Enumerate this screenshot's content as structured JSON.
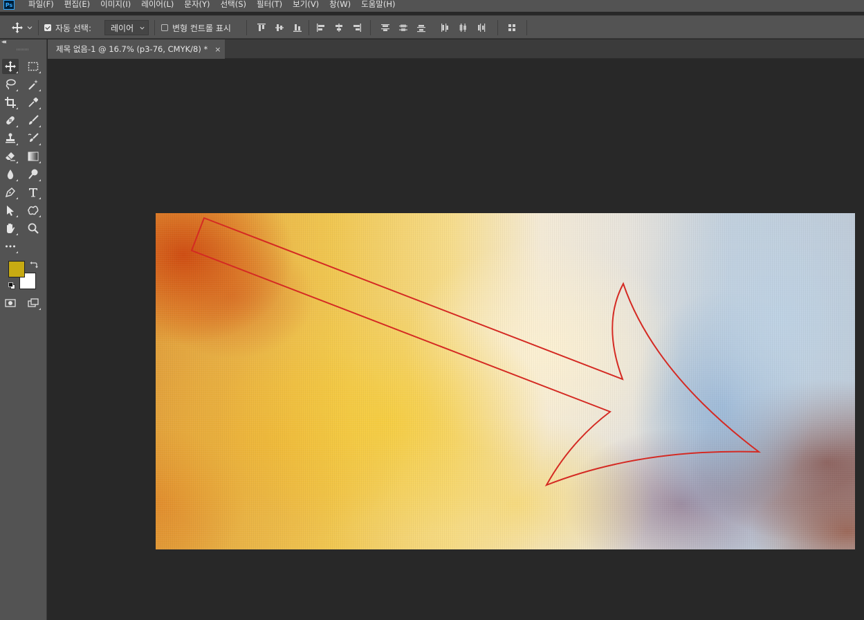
{
  "app": {
    "logo": "Ps",
    "menu": [
      "파일(F)",
      "편집(E)",
      "이미지(I)",
      "레이어(L)",
      "문자(Y)",
      "선택(S)",
      "필터(T)",
      "보기(V)",
      "창(W)",
      "도움말(H)"
    ]
  },
  "options_bar": {
    "tool_icon": "move-icon",
    "auto_select_checked": true,
    "auto_select_label": "자동 선택:",
    "auto_select_value": "레이어",
    "show_transform_checked": false,
    "show_transform_label": "변형 컨트롤 표시"
  },
  "document": {
    "tab_title": "제목 없음-1 @ 16.7% (p3-76, CMYK/8) *",
    "close_glyph": "×"
  },
  "toolbox": {
    "tools": [
      "move-tool",
      "marquee-tool",
      "lasso-tool",
      "magic-wand-tool",
      "crop-tool",
      "eyedropper-tool",
      "healing-brush-tool",
      "brush-tool",
      "clone-stamp-tool",
      "history-brush-tool",
      "eraser-tool",
      "gradient-tool",
      "blur-tool",
      "dodge-tool",
      "pen-tool",
      "type-tool",
      "path-selection-tool",
      "custom-shape-tool",
      "hand-tool",
      "zoom-tool",
      "edit-toolbar"
    ],
    "foreground_color": "#c7aa12",
    "background_color": "#ffffff"
  },
  "colors": {
    "ui_bar": "#535353",
    "canvas_bg": "#282828",
    "arrow_stroke": "#d42a23"
  }
}
